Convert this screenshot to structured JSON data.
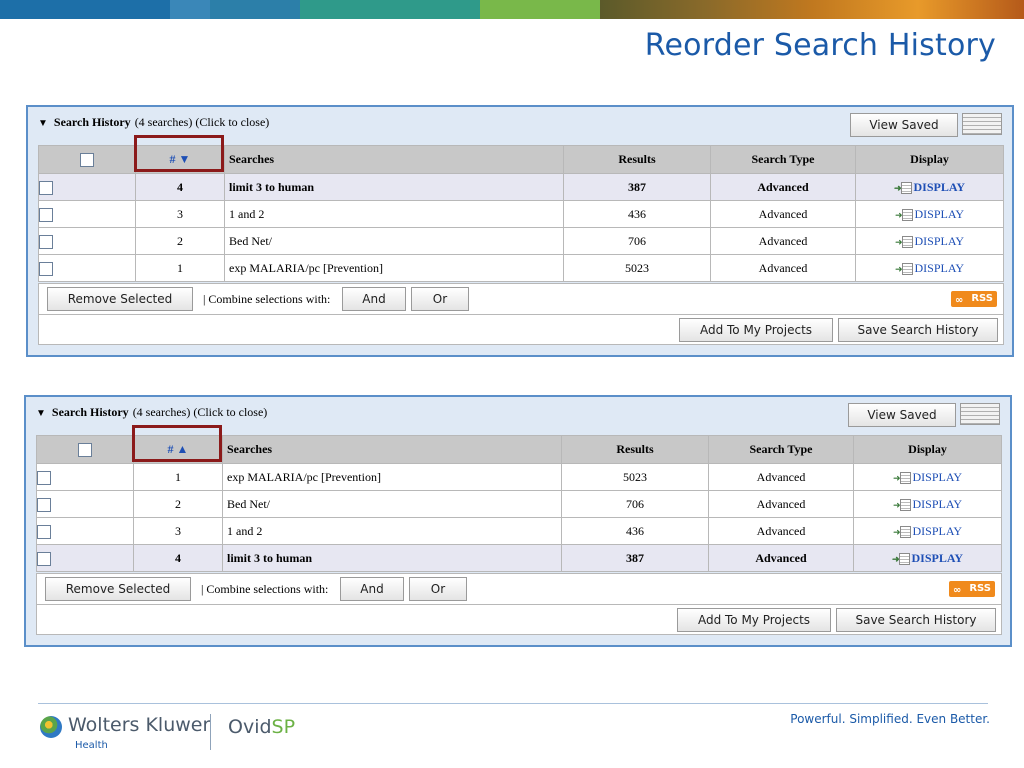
{
  "slide_title": "Reorder Search History",
  "colors": {
    "title": "#1b5aa8",
    "panel_border": "#5b8fc9",
    "highlight": "#8b1a1a",
    "link": "#1e4fb5",
    "rss": "#f08a1c"
  },
  "panels": [
    {
      "head_title": "Search History",
      "head_sub": "(4 searches) (Click to close)",
      "view_saved": "View Saved",
      "columns": {
        "num": "# ▼",
        "searches": "Searches",
        "results": "Results",
        "type": "Search Type",
        "display": "Display"
      },
      "rows": [
        {
          "num": "4",
          "search": "limit 3 to human",
          "results": "387",
          "type": "Advanced",
          "display": "DISPLAY"
        },
        {
          "num": "3",
          "search": "1 and 2",
          "results": "436",
          "type": "Advanced",
          "display": "DISPLAY"
        },
        {
          "num": "2",
          "search": "Bed Net/",
          "results": "706",
          "type": "Advanced",
          "display": "DISPLAY"
        },
        {
          "num": "1",
          "search": "exp MALARIA/pc [Prevention]",
          "results": "5023",
          "type": "Advanced",
          "display": "DISPLAY"
        }
      ],
      "remove_selected": "Remove Selected",
      "combine_label": "| Combine selections with:",
      "and": "And",
      "or": "Or",
      "rss": "RSS",
      "add_to_projects": "Add To My Projects",
      "save_history": "Save Search History"
    },
    {
      "head_title": "Search History",
      "head_sub": "(4 searches) (Click to close)",
      "view_saved": "View Saved",
      "columns": {
        "num": "# ▲",
        "searches": "Searches",
        "results": "Results",
        "type": "Search Type",
        "display": "Display"
      },
      "rows": [
        {
          "num": "1",
          "search": "exp MALARIA/pc [Prevention]",
          "results": "5023",
          "type": "Advanced",
          "display": "DISPLAY"
        },
        {
          "num": "2",
          "search": "Bed Net/",
          "results": "706",
          "type": "Advanced",
          "display": "DISPLAY"
        },
        {
          "num": "3",
          "search": "1 and 2",
          "results": "436",
          "type": "Advanced",
          "display": "DISPLAY"
        },
        {
          "num": "4",
          "search": "limit 3 to human",
          "results": "387",
          "type": "Advanced",
          "display": "DISPLAY"
        }
      ],
      "remove_selected": "Remove Selected",
      "combine_label": "| Combine selections with:",
      "and": "And",
      "or": "Or",
      "rss": "RSS",
      "add_to_projects": "Add To My Projects",
      "save_history": "Save Search History"
    }
  ],
  "footer": {
    "brand": "Wolters Kluwer",
    "brand_sub": "Health",
    "product_a": "Ovid",
    "product_b": "SP",
    "tagline": "Powerful. Simplified. Even Better."
  }
}
